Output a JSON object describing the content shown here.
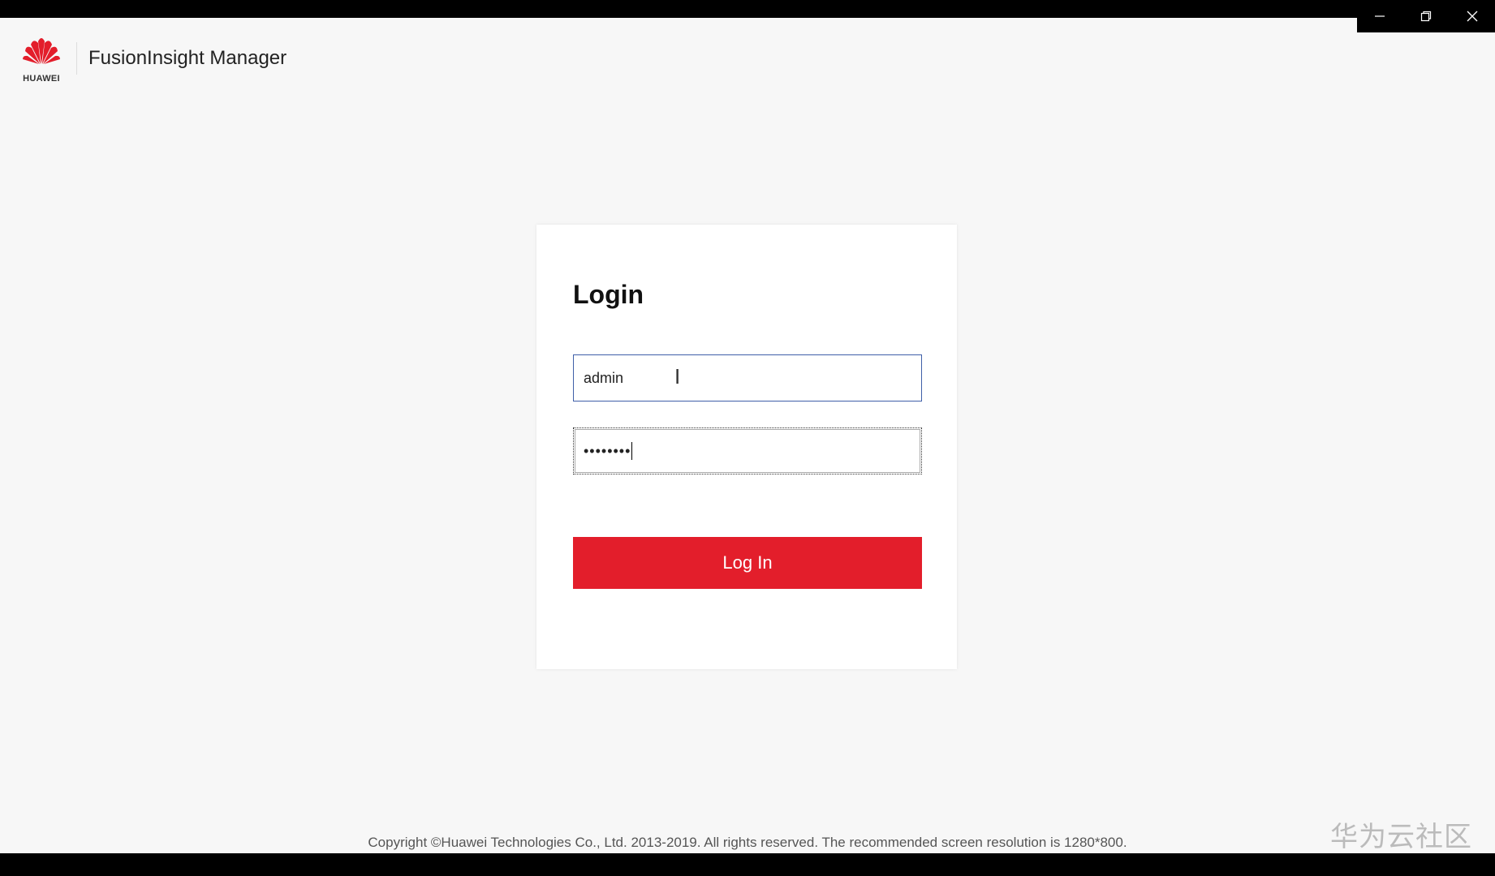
{
  "window": {
    "controls": [
      "minimize",
      "restore",
      "close"
    ]
  },
  "header": {
    "brand": "HUAWEI",
    "app_title": "FusionInsight Manager"
  },
  "login": {
    "title": "Login",
    "username_value": "admin",
    "password_value": "••••••••",
    "button_label": "Log In"
  },
  "footer": {
    "copyright": "Copyright ©Huawei Technologies Co., Ltd. 2013-2019. All rights reserved. The recommended screen resolution is 1280*800."
  },
  "watermark": "华为云社区",
  "colors": {
    "accent": "#e31e2b",
    "background": "#f7f7f7",
    "input_focus_border": "#3f5fa8"
  }
}
